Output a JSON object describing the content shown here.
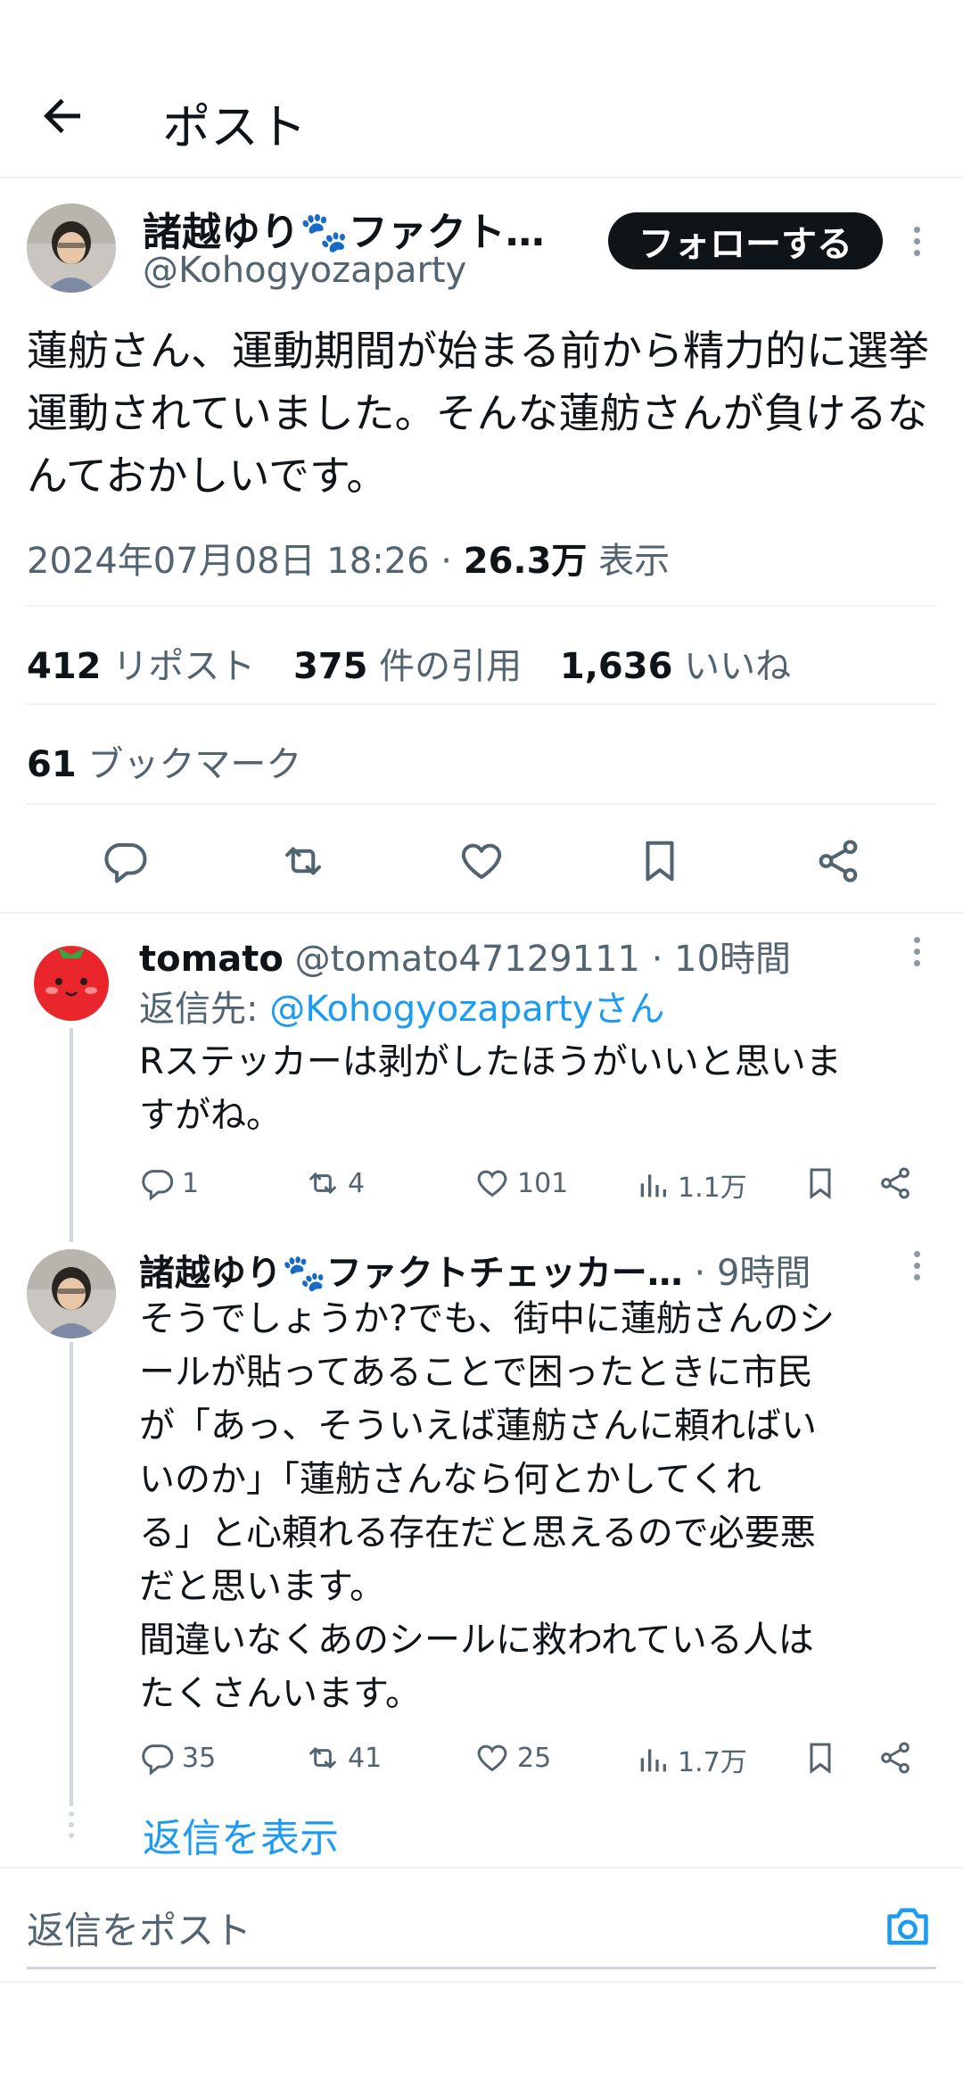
{
  "header": {
    "title": "ポスト"
  },
  "post": {
    "author_name": "諸越ゆり🐾ファクト…",
    "author_handle": "@Kohogyozaparty",
    "follow_label": "フォローする",
    "text": "蓮舫さん、運動期間が始まる前から精力的に選挙運動されていました。そんな蓮舫さんが負けるなんておかしいです。",
    "timestamp": "2024年07月08日 18:26 · ",
    "views_count": "26.3万",
    "views_label": " 表示",
    "reposts_count": "412",
    "reposts_label": " リポスト",
    "quotes_count": "375",
    "quotes_label": " 件の引用",
    "likes_count": "1,636",
    "likes_label": " いいね",
    "bookmarks_count": "61",
    "bookmarks_label": " ブックマーク"
  },
  "replies": [
    {
      "author_name": "tomato",
      "author_handle": "@tomato47129111 · 10時間",
      "reply_to_prefix": "返信先: ",
      "reply_to_handle": "@Kohogyozapartyさん",
      "text_lines": [
        "Rステッカーは剥がしたほうがいいと思いま",
        "すがね。"
      ],
      "replies": "1",
      "reposts": "4",
      "likes": "101",
      "views": "1.1万"
    },
    {
      "author_name": "諸越ゆり🐾ファクトチェッカー…",
      "author_handle": " · 9時間",
      "text_lines": [
        "そうでしょうか?でも、街中に蓮舫さんのシ",
        "ールが貼ってあることで困ったときに市民",
        "が「あっ、そういえば蓮舫さんに頼ればい",
        "いのか」「蓮舫さんなら何とかしてくれ",
        "る」と心頼れる存在だと思えるので必要悪",
        "だと思います。",
        "間違いなくあのシールに救われている人は",
        "たくさんいます。"
      ],
      "replies": "35",
      "reposts": "41",
      "likes": "25",
      "views": "1.7万"
    }
  ],
  "show_replies_label": "返信を表示",
  "compose": {
    "placeholder": "返信をポスト"
  },
  "colors": {
    "accent": "#1d9bf0",
    "text": "#0f1419",
    "muted": "#536471",
    "divider": "#eff3f4"
  }
}
